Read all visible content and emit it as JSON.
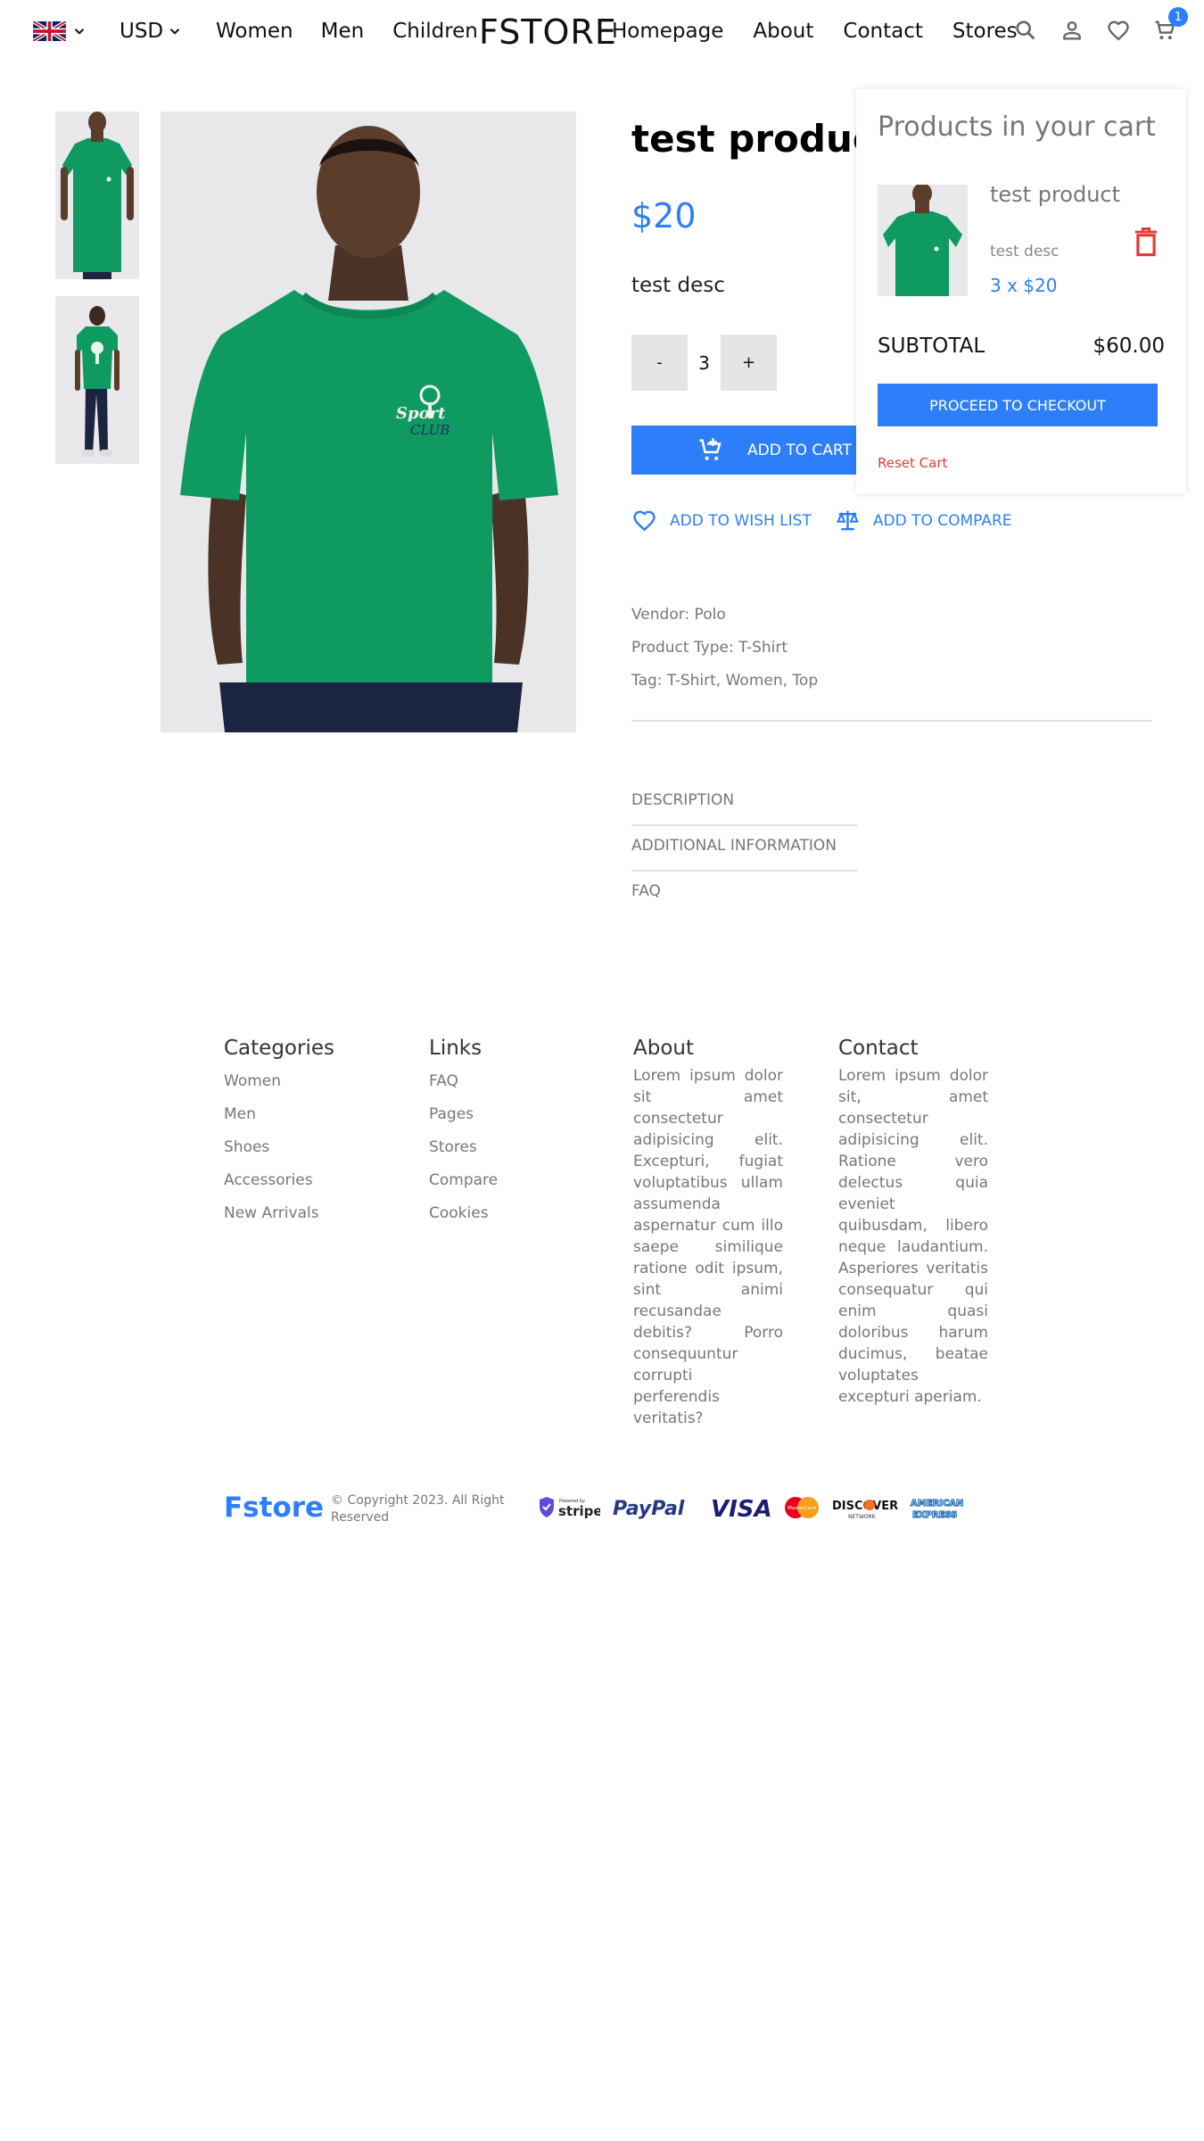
{
  "navbar": {
    "currency": "USD",
    "left_links": [
      "Women",
      "Men",
      "Children"
    ],
    "logo": "FSTORE",
    "right_links": [
      "Homepage",
      "About",
      "Contact",
      "Stores"
    ],
    "cart_count": "1"
  },
  "product": {
    "title": "test product",
    "price": "$20",
    "description": "test desc",
    "quantity": "3",
    "qty_minus": "-",
    "qty_plus": "+",
    "add_to_cart": "ADD TO CART",
    "wish_list": "ADD TO WISH LIST",
    "compare": "ADD TO COMPARE",
    "image_print": [
      "Sport",
      "CLUB"
    ],
    "meta": {
      "vendor": "Vendor: Polo",
      "type": "Product Type: T-Shirt",
      "tags": "Tag: T-Shirt, Women, Top"
    },
    "tabs": [
      "DESCRIPTION",
      "ADDITIONAL INFORMATION",
      "FAQ"
    ]
  },
  "cart": {
    "title": "Products in your cart",
    "item": {
      "name": "test product",
      "desc": "test desc",
      "qty_price": "3 x $20"
    },
    "subtotal_label": "SUBTOTAL",
    "subtotal_value": "$60.00",
    "checkout": "PROCEED TO CHECKOUT",
    "reset": "Reset Cart"
  },
  "footer": {
    "categories": {
      "title": "Categories",
      "items": [
        "Women",
        "Men",
        "Shoes",
        "Accessories",
        "New Arrivals"
      ]
    },
    "links": {
      "title": "Links",
      "items": [
        "FAQ",
        "Pages",
        "Stores",
        "Compare",
        "Cookies"
      ]
    },
    "about": {
      "title": "About",
      "text": "Lorem ipsum dolor sit amet consectetur adipisicing elit. Excepturi, fugiat voluptatibus ullam assumenda aspernatur cum illo saepe similique ratione odit ipsum, sint animi recusandae debitis? Porro consequuntur corrupti perferendis veritatis?"
    },
    "contact": {
      "title": "Contact",
      "text": "Lorem ipsum dolor sit, amet consectetur adipisicing elit. Ratione vero delectus quia eveniet quibusdam, libero neque laudantium. Asperiores veritatis consequatur qui enim quasi doloribus harum ducimus, beatae voluptates excepturi aperiam."
    },
    "brand": "Fstore",
    "copyright": "© Copyright 2023. All Right Reserved",
    "payments": {
      "stripe_small": "Powered by",
      "stripe": "stripe",
      "paypal": "PayPal",
      "visa": "VISA",
      "mastercard": "MasterCard",
      "discover": "DISCOVER",
      "discover_sub": "NETWORK",
      "amex_1": "AMERICAN",
      "amex_2": "EXPRESS"
    }
  },
  "colors": {
    "accent": "#2d7ff9",
    "danger": "#e53935",
    "shirt": "#0f9a62"
  }
}
